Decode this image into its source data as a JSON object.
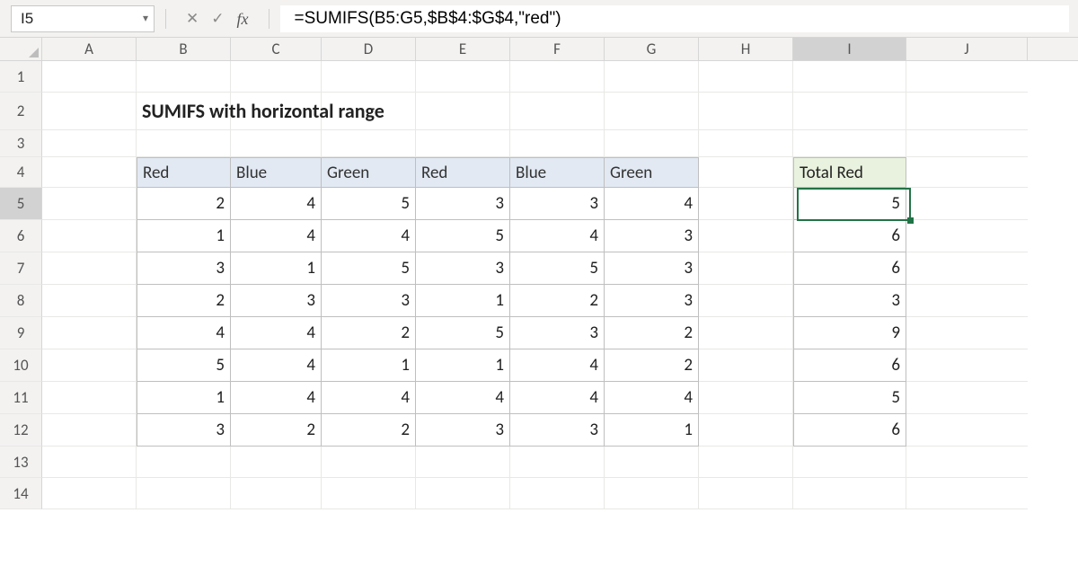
{
  "formula_bar": {
    "cell_ref": "I5",
    "formula": "=SUMIFS(B5:G5,$B$4:$G$4,\"red\")",
    "fx_label": "fx"
  },
  "columns": [
    "A",
    "B",
    "C",
    "D",
    "E",
    "F",
    "G",
    "H",
    "I",
    "J"
  ],
  "rows": [
    "1",
    "2",
    "3",
    "4",
    "5",
    "6",
    "7",
    "8",
    "9",
    "10",
    "11",
    "12",
    "13",
    "14"
  ],
  "title": "SUMIFS with horizontal range",
  "table_headers": [
    "Red",
    "Blue",
    "Green",
    "Red",
    "Blue",
    "Green"
  ],
  "data": [
    [
      2,
      4,
      5,
      3,
      3,
      4
    ],
    [
      1,
      4,
      4,
      5,
      4,
      3
    ],
    [
      3,
      1,
      5,
      3,
      5,
      3
    ],
    [
      2,
      3,
      3,
      1,
      2,
      3
    ],
    [
      4,
      4,
      2,
      5,
      3,
      2
    ],
    [
      5,
      4,
      1,
      1,
      4,
      2
    ],
    [
      1,
      4,
      4,
      4,
      4,
      4
    ],
    [
      3,
      2,
      2,
      3,
      3,
      1
    ]
  ],
  "total_header": "Total Red",
  "totals": [
    5,
    6,
    6,
    3,
    9,
    6,
    5,
    6
  ],
  "selected_cell": "I5",
  "selected_col": "I",
  "selected_row": "5",
  "chart_data": {
    "type": "table",
    "title": "SUMIFS with horizontal range",
    "columns": [
      "Red",
      "Blue",
      "Green",
      "Red",
      "Blue",
      "Green",
      "Total Red"
    ],
    "rows": [
      [
        2,
        4,
        5,
        3,
        3,
        4,
        5
      ],
      [
        1,
        4,
        4,
        5,
        4,
        3,
        6
      ],
      [
        3,
        1,
        5,
        3,
        5,
        3,
        6
      ],
      [
        2,
        3,
        3,
        1,
        2,
        3,
        3
      ],
      [
        4,
        4,
        2,
        5,
        3,
        2,
        9
      ],
      [
        5,
        4,
        1,
        1,
        4,
        2,
        6
      ],
      [
        1,
        4,
        4,
        4,
        4,
        4,
        5
      ],
      [
        3,
        2,
        2,
        3,
        3,
        1,
        6
      ]
    ]
  }
}
